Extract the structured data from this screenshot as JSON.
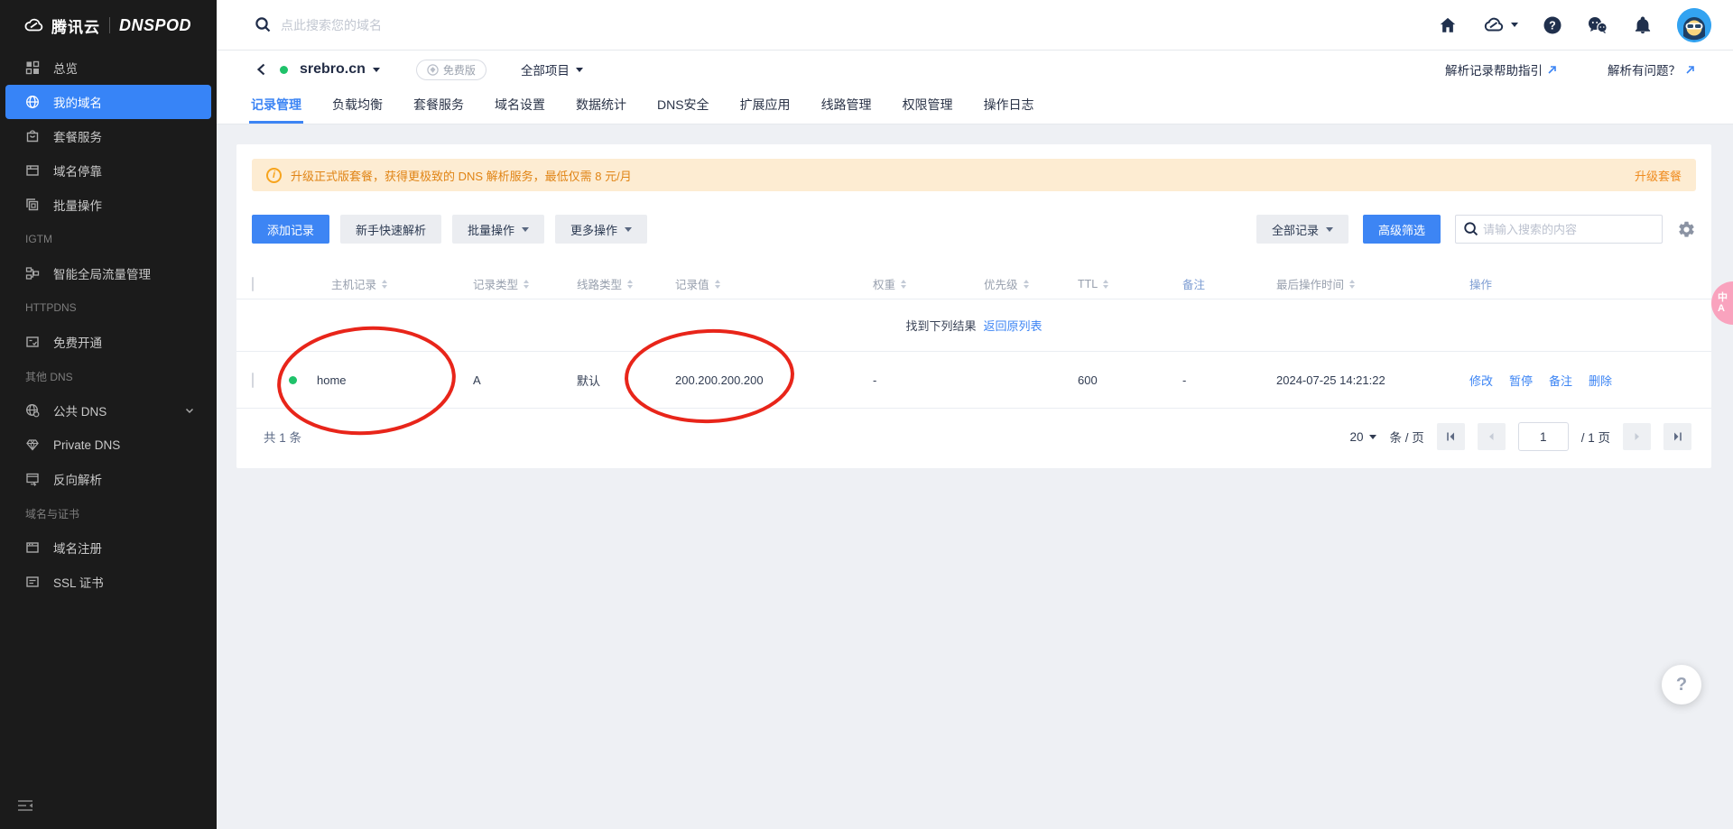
{
  "brand": {
    "tencent": "腾讯云",
    "product": "DNSPOD"
  },
  "topbar": {
    "search_placeholder": "点此搜索您的域名"
  },
  "sidebar": {
    "groups": [
      {
        "label": "",
        "items": [
          {
            "label": "总览",
            "icon": "grid-icon",
            "active": false
          },
          {
            "label": "我的域名",
            "icon": "globe-icon",
            "active": true
          },
          {
            "label": "套餐服务",
            "icon": "package-icon",
            "active": false
          },
          {
            "label": "域名停靠",
            "icon": "browser-icon",
            "active": false
          },
          {
            "label": "批量操作",
            "icon": "layers-icon",
            "active": false
          }
        ]
      },
      {
        "label": "IGTM",
        "items": [
          {
            "label": "智能全局流量管理",
            "icon": "traffic-icon"
          }
        ]
      },
      {
        "label": "HTTPDNS",
        "items": [
          {
            "label": "免费开通",
            "icon": "card-check-icon"
          }
        ]
      },
      {
        "label": "其他 DNS",
        "items": [
          {
            "label": "公共 DNS",
            "icon": "public-dns-icon",
            "expandable": true
          },
          {
            "label": "Private DNS",
            "icon": "gem-icon"
          },
          {
            "label": "反向解析",
            "icon": "swap-icon"
          }
        ]
      },
      {
        "label": "域名与证书",
        "items": [
          {
            "label": "域名注册",
            "icon": "window-icon"
          },
          {
            "label": "SSL 证书",
            "icon": "certificate-icon"
          }
        ]
      }
    ]
  },
  "domain_header": {
    "domain": "srebro.cn",
    "plan_badge": "免费版",
    "project_selector": "全部项目",
    "help_links": [
      "解析记录帮助指引",
      "解析有问题？"
    ]
  },
  "tabs": [
    "记录管理",
    "负载均衡",
    "套餐服务",
    "域名设置",
    "数据统计",
    "DNS安全",
    "扩展应用",
    "线路管理",
    "权限管理",
    "操作日志"
  ],
  "banner": {
    "text": "升级正式版套餐，获得更极致的 DNS 解析服务，最低仅需 8 元/月",
    "action": "升级套餐"
  },
  "toolbar": {
    "add": "添加记录",
    "quick": "新手快速解析",
    "batch": "批量操作",
    "more": "更多操作",
    "filter_all": "全部记录",
    "advanced": "高级筛选",
    "search_placeholder": "请输入搜索的内容"
  },
  "table": {
    "columns": [
      {
        "label": "主机记录",
        "sortable": true
      },
      {
        "label": "记录类型",
        "sortable": true
      },
      {
        "label": "线路类型",
        "sortable": true
      },
      {
        "label": "记录值",
        "sortable": true
      },
      {
        "label": "权重",
        "sortable": true
      },
      {
        "label": "优先级",
        "sortable": true
      },
      {
        "label": "TTL",
        "sortable": true
      },
      {
        "label": "备注",
        "sortable": false
      },
      {
        "label": "最后操作时间",
        "sortable": true
      },
      {
        "label": "操作",
        "sortable": false
      }
    ],
    "notice": {
      "found": "找到下列结果",
      "back": "返回原列表"
    },
    "rows": [
      {
        "host": "home",
        "type": "A",
        "line": "默认",
        "value": "200.200.200.200",
        "weight": "-",
        "priority": "",
        "ttl": "600",
        "remark": "-",
        "updated": "2024-07-25 14:21:22",
        "ops": [
          "修改",
          "暂停",
          "备注",
          "删除"
        ]
      }
    ]
  },
  "pagination": {
    "total": "共 1 条",
    "page_size": "20",
    "unit": "条 / 页",
    "page": "1",
    "of": "/ 1 页"
  },
  "floating": {
    "help": "?",
    "lang_top": "中",
    "lang_bottom": "A"
  },
  "colors": {
    "accent": "#3d85f4",
    "sidebar_active": "#3784f7",
    "banner_bg": "#fdecd2",
    "banner_text": "#e08415",
    "success_dot": "#1fc26a",
    "annotation": "#e8251a"
  }
}
